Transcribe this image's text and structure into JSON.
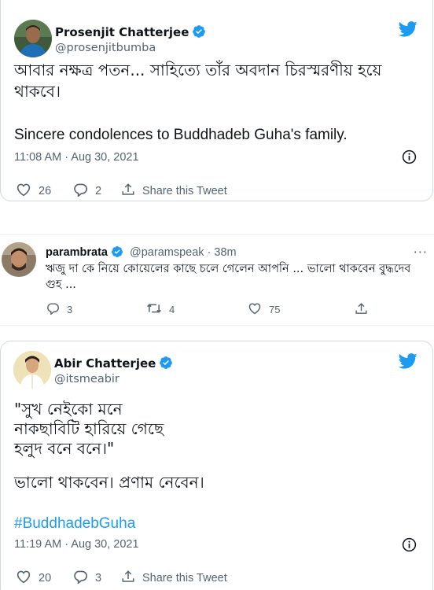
{
  "tweet1": {
    "name": "Prosenjit Chatterjee",
    "handle": "@prosenjitbumba",
    "text_line1": "আবার নক্ষত্র পতন... সাহিত্যে তাঁর অবদান চিরস্মরণীয় হয়ে",
    "text_line2": "থাকবে।",
    "text_en": "Sincere condolences to Buddhadeb Guha's family.",
    "timestamp": "11:08 AM · Aug 30, 2021",
    "likes": "26",
    "replies": "2",
    "share_label": "Share this Tweet"
  },
  "tweet2": {
    "name": "parambrata",
    "handle": "@paramspeak · 38m",
    "more": "···",
    "text_line1": "ঋজু দা কে নিয়ে কোয়েলের কাছে চলে গেলেন আপনি ... ভালো থাকবেন বুদ্ধদেব",
    "text_line2": "গুহ ...",
    "replies": "3",
    "retweets": "4",
    "likes": "75"
  },
  "tweet3": {
    "name": "Abir Chatterjee",
    "handle": "@itsmeabir",
    "lines": [
      "\"সুখ নেইকো মনে",
      "নাকছাবিটি হারিয়ে গেছে",
      "হলুদ বনে বনে।\""
    ],
    "line4": "ভালো থাকবেন। প্রণাম নেবেন।",
    "hashtag": "#BuddhadebGuha",
    "timestamp": "11:19 AM · Aug 30, 2021",
    "likes": "20",
    "replies": "3",
    "share_label": "Share this Tweet"
  },
  "colors": {
    "twitter_blue": "#1d9bf0",
    "secondary_text": "#536471",
    "border": "#cfd9de"
  },
  "icons": [
    "twitter-bird-icon",
    "verified-badge-icon",
    "info-icon",
    "heart-icon",
    "reply-icon",
    "retweet-icon",
    "share-icon",
    "more-icon"
  ]
}
